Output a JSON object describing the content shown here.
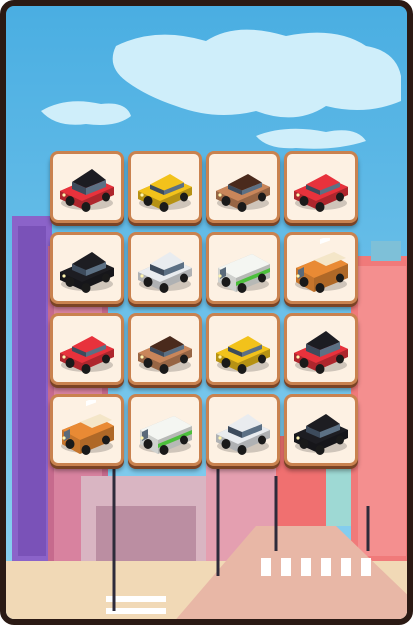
{
  "board": {
    "columns": 4,
    "rows": 4,
    "tiles": [
      {
        "car": "red-smart-car-icon",
        "body": "#e8323c",
        "roof": "#1c1c22",
        "kind": "smart"
      },
      {
        "car": "yellow-hatchback-icon",
        "body": "#f2c21b",
        "roof": "#f2c21b",
        "kind": "hatch"
      },
      {
        "car": "brown-sedan-icon",
        "body": "#c9865a",
        "roof": "#4a2a1c",
        "kind": "sedan"
      },
      {
        "car": "red-hatchback-icon",
        "body": "#e8323c",
        "roof": "#e8323c",
        "kind": "hatch"
      },
      {
        "car": "black-suv-icon",
        "body": "#1d1d22",
        "roof": "#1d1d22",
        "kind": "suv"
      },
      {
        "car": "white-suv-icon",
        "body": "#e9ecef",
        "roof": "#e9ecef",
        "kind": "suv"
      },
      {
        "car": "green-van-icon",
        "body": "#f4f6f2",
        "roof": "#f4f6f2",
        "kind": "van",
        "stripe": "#4cbf3c"
      },
      {
        "car": "orange-truck-icon",
        "body": "#e98a34",
        "roof": "#e98a34",
        "kind": "truck"
      },
      {
        "car": "red-hatchback-icon",
        "body": "#e8323c",
        "roof": "#e8323c",
        "kind": "hatch"
      },
      {
        "car": "brown-sedan-icon",
        "body": "#c9865a",
        "roof": "#4a2a1c",
        "kind": "sedan"
      },
      {
        "car": "yellow-hatchback-icon",
        "body": "#f2c21b",
        "roof": "#f2c21b",
        "kind": "hatch"
      },
      {
        "car": "red-smart-car-icon",
        "body": "#e8323c",
        "roof": "#1c1c22",
        "kind": "smart"
      },
      {
        "car": "orange-truck-icon",
        "body": "#e98a34",
        "roof": "#e98a34",
        "kind": "truck"
      },
      {
        "car": "green-van-icon",
        "body": "#f4f6f2",
        "roof": "#f4f6f2",
        "kind": "van",
        "stripe": "#4cbf3c"
      },
      {
        "car": "white-suv-icon",
        "body": "#e9ecef",
        "roof": "#e9ecef",
        "kind": "suv"
      },
      {
        "car": "black-suv-icon",
        "body": "#1d1d22",
        "roof": "#1d1d22",
        "kind": "suv"
      }
    ]
  },
  "colors": {
    "sky": "#5ab7e6",
    "frame": "#2b1a14",
    "tile_face": "#fdf1e3",
    "tile_border": "#c9824f"
  }
}
